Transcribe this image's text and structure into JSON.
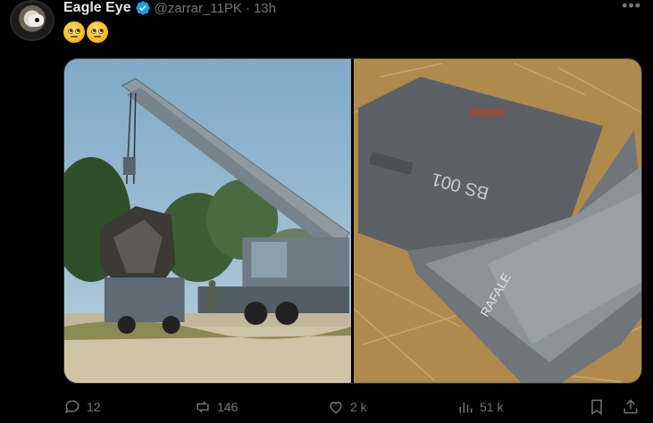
{
  "post": {
    "author_name": "Eagle Eye",
    "handle": "@zarrar_11PK",
    "separator": "·",
    "time": "13h",
    "more_label": "•••",
    "text_emojis": [
      "face-with-rolling-eyes",
      "face-with-rolling-eyes"
    ]
  },
  "media": {
    "left_image": "crane lifting aircraft wreckage",
    "right_image": "aircraft tail fin wreckage",
    "right_image_markings": [
      "BS 001",
      "RAFALE"
    ]
  },
  "actions": {
    "replies": "12",
    "reposts": "146",
    "likes": "2 k",
    "views": "51 k"
  },
  "colors": {
    "background": "#000000",
    "text_primary": "#e7e9ea",
    "text_secondary": "#71767b",
    "verified": "#1d9bf0"
  }
}
